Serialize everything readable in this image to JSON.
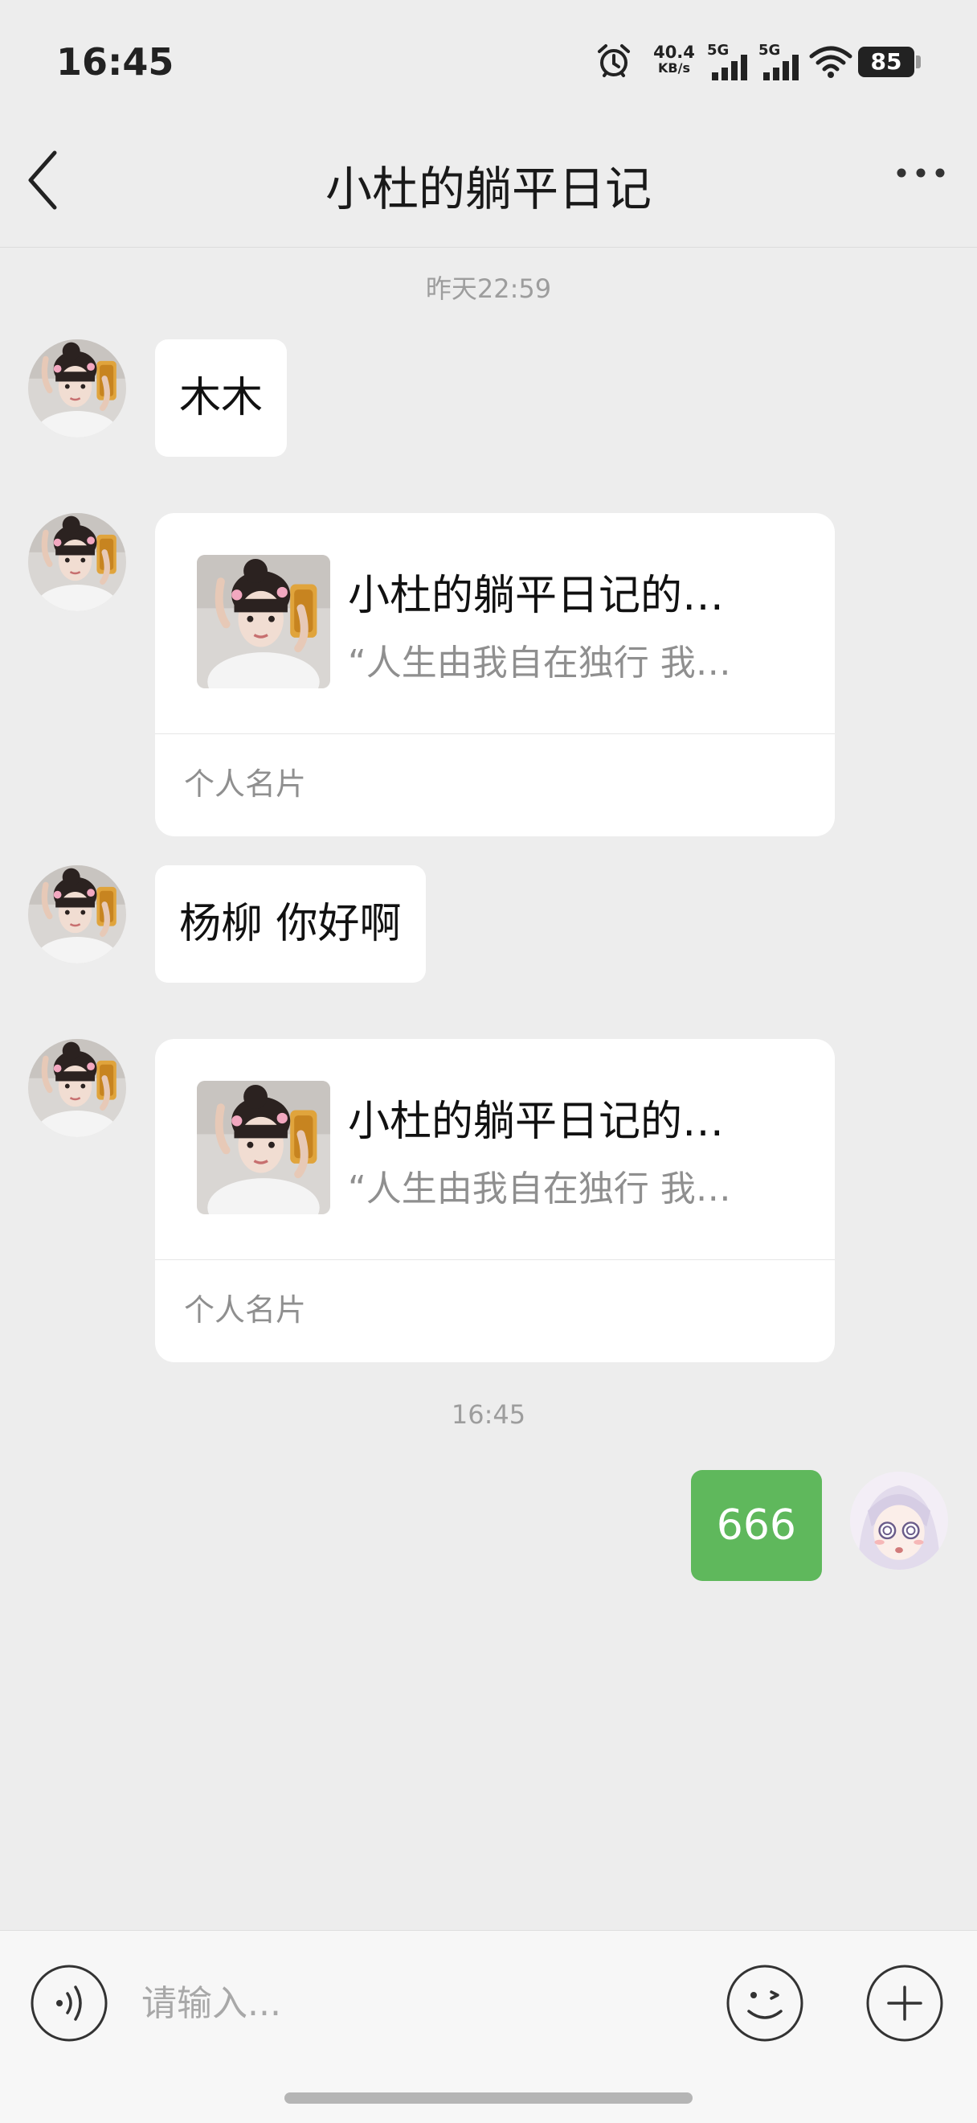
{
  "status_bar": {
    "time": "16:45",
    "net_speed": "40.4",
    "net_speed_unit": "KB/s",
    "signal_1": "5G",
    "signal_2": "5G",
    "battery": "85"
  },
  "header": {
    "title": "小杜的躺平日记",
    "back_icon": "chevron-left-icon",
    "more_icon": "more-dots-icon"
  },
  "timestamps": [
    "昨天22:59",
    "16:45"
  ],
  "messages": {
    "m1": {
      "sender": "contact",
      "text": "木木"
    },
    "m2": {
      "sender": "contact",
      "type": "contact-card",
      "title": "小杜的躺平日记的…",
      "subtitle": "“人生由我自在独行 我…",
      "footer": "个人名片"
    },
    "m3": {
      "sender": "contact",
      "text": "杨柳 你好啊"
    },
    "m4": {
      "sender": "contact",
      "type": "contact-card",
      "title": "小杜的躺平日记的…",
      "subtitle": "“人生由我自在独行 我…",
      "footer": "个人名片"
    },
    "m5": {
      "sender": "me",
      "text": "666"
    }
  },
  "input_bar": {
    "placeholder": "请输入...",
    "voice_icon": "voice-icon",
    "emoji_icon": "emoji-icon",
    "plus_icon": "plus-icon"
  },
  "colors": {
    "background": "#ededed",
    "bubble_in": "#ffffff",
    "bubble_out": "#5fb85c",
    "muted_text": "#9d9d9d"
  }
}
